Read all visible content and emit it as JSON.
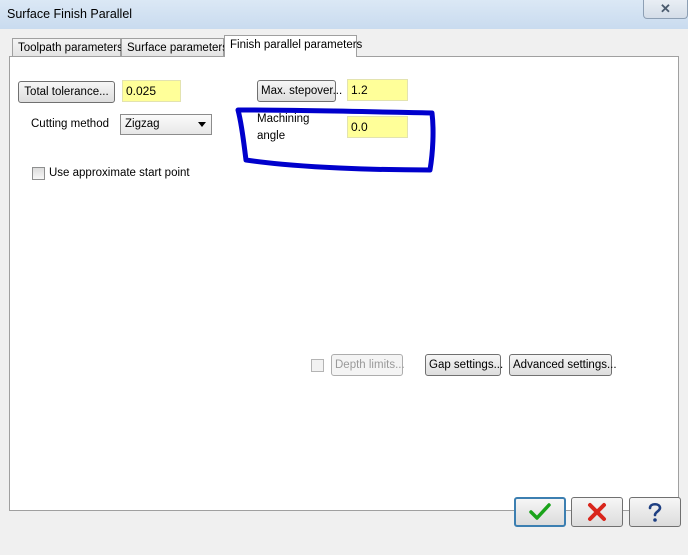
{
  "window": {
    "title": "Surface Finish Parallel",
    "close_glyph": "✕"
  },
  "tabs": [
    {
      "label": "Toolpath parameters"
    },
    {
      "label": "Surface parameters"
    },
    {
      "label": "Finish parallel parameters"
    }
  ],
  "params": {
    "total_tolerance_label": "Total tolerance...",
    "total_tolerance_value": "0.025",
    "max_stepover_label": "Max. stepover...",
    "max_stepover_value": "1.2",
    "cutting_method_label": "Cutting method",
    "cutting_method_value": "Zigzag",
    "machining_angle_label_line1": "Machining",
    "machining_angle_label_line2": "angle",
    "machining_angle_value": "0.0",
    "approx_start_label": "Use approximate start point"
  },
  "actions": {
    "depth_limits_label": "Depth limits...",
    "gap_settings_label": "Gap settings...",
    "advanced_settings_label": "Advanced settings..."
  },
  "footer": {
    "ok_icon": "check-icon",
    "cancel_icon": "x-icon",
    "help_icon": "help-icon"
  },
  "colors": {
    "field_highlight": "#ffff99",
    "annotation_blue": "#0000cc",
    "ok_green": "#1aa31a",
    "cancel_red": "#d9261c"
  }
}
